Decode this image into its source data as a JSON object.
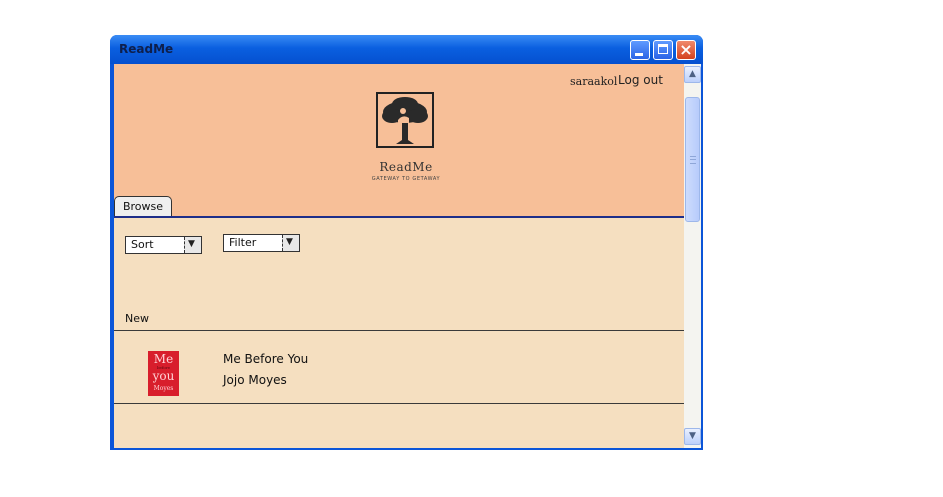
{
  "window": {
    "title": "ReadMe"
  },
  "header": {
    "username": "saraakol",
    "logout_label": "Log out",
    "logo_name": "ReadMe",
    "logo_tagline": "GATEWAY TO GETAWAY",
    "background_color": "#f7bf98"
  },
  "tabs": [
    {
      "label": "Browse"
    }
  ],
  "controls": {
    "sort": {
      "selected": "Sort"
    },
    "filter": {
      "selected": "Filter"
    }
  },
  "section": {
    "label": "New"
  },
  "books": [
    {
      "title": "Me Before You",
      "author": "Jojo Moyes",
      "cover_text": [
        "Me",
        "before",
        "you",
        "Moyes"
      ],
      "cover_color": "#d81e2c"
    }
  ],
  "colors": {
    "content_background": "#f5dfc0",
    "window_frame": "#0b55d8"
  }
}
